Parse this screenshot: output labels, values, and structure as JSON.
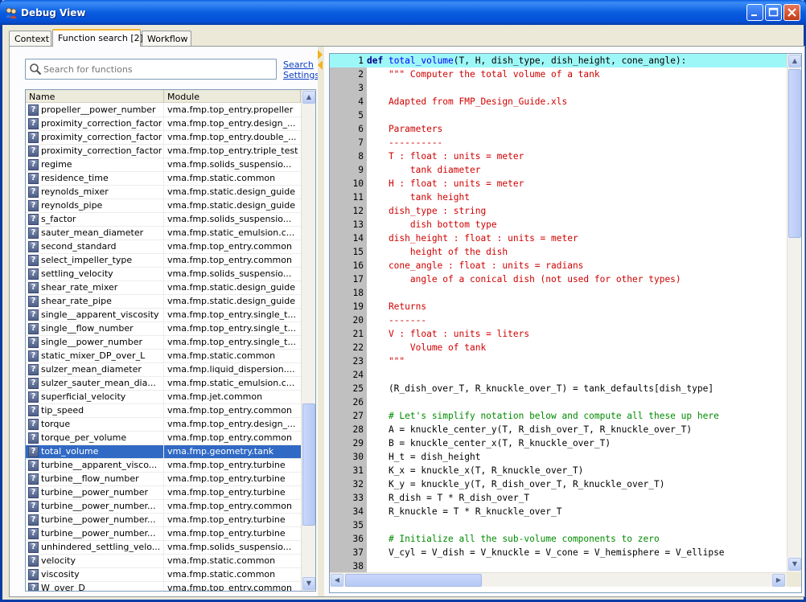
{
  "window": {
    "title": "Debug View"
  },
  "tabs": [
    {
      "label": "Context",
      "active": false
    },
    {
      "label": "Function search [2]",
      "active": true
    },
    {
      "label": "Workflow",
      "active": false
    }
  ],
  "search": {
    "placeholder": "Search for functions",
    "value": "",
    "settings_link": "Search Settings"
  },
  "list": {
    "columns": [
      "Name",
      "Module"
    ],
    "rows": [
      {
        "name": "propeller__power_number",
        "module": "vma.fmp.top_entry.propeller"
      },
      {
        "name": "proximity_correction_factor",
        "module": "vma.fmp.top_entry.design_..."
      },
      {
        "name": "proximity_correction_factor",
        "module": "vma.fmp.top_entry.double_..."
      },
      {
        "name": "proximity_correction_factor",
        "module": "vma.fmp.top_entry.triple_test"
      },
      {
        "name": "regime",
        "module": "vma.fmp.solids_suspensio..."
      },
      {
        "name": "residence_time",
        "module": "vma.fmp.static.common"
      },
      {
        "name": "reynolds_mixer",
        "module": "vma.fmp.static.design_guide"
      },
      {
        "name": "reynolds_pipe",
        "module": "vma.fmp.static.design_guide"
      },
      {
        "name": "s_factor",
        "module": "vma.fmp.solids_suspensio..."
      },
      {
        "name": "sauter_mean_diameter",
        "module": "vma.fmp.static_emulsion.c..."
      },
      {
        "name": "second_standard",
        "module": "vma.fmp.top_entry.common"
      },
      {
        "name": "select_impeller_type",
        "module": "vma.fmp.top_entry.common"
      },
      {
        "name": "settling_velocity",
        "module": "vma.fmp.solids_suspensio..."
      },
      {
        "name": "shear_rate_mixer",
        "module": "vma.fmp.static.design_guide"
      },
      {
        "name": "shear_rate_pipe",
        "module": "vma.fmp.static.design_guide"
      },
      {
        "name": "single__apparent_viscosity",
        "module": "vma.fmp.top_entry.single_t..."
      },
      {
        "name": "single__flow_number",
        "module": "vma.fmp.top_entry.single_t..."
      },
      {
        "name": "single__power_number",
        "module": "vma.fmp.top_entry.single_t..."
      },
      {
        "name": "static_mixer_DP_over_L",
        "module": "vma.fmp.static.common"
      },
      {
        "name": "sulzer_mean_diameter",
        "module": "vma.fmp.liquid_dispersion...."
      },
      {
        "name": "sulzer_sauter_mean_dia...",
        "module": "vma.fmp.static_emulsion.c..."
      },
      {
        "name": "superficial_velocity",
        "module": "vma.fmp.jet.common"
      },
      {
        "name": "tip_speed",
        "module": "vma.fmp.top_entry.common"
      },
      {
        "name": "torque",
        "module": "vma.fmp.top_entry.design_..."
      },
      {
        "name": "torque_per_volume",
        "module": "vma.fmp.top_entry.common"
      },
      {
        "name": "total_volume",
        "module": "vma.fmp.geometry.tank",
        "selected": true
      },
      {
        "name": "turbine__apparent_visco...",
        "module": "vma.fmp.top_entry.turbine"
      },
      {
        "name": "turbine__flow_number",
        "module": "vma.fmp.top_entry.turbine"
      },
      {
        "name": "turbine__power_number",
        "module": "vma.fmp.top_entry.turbine"
      },
      {
        "name": "turbine__power_number...",
        "module": "vma.fmp.top_entry.common"
      },
      {
        "name": "turbine__power_number...",
        "module": "vma.fmp.top_entry.turbine"
      },
      {
        "name": "turbine__power_number...",
        "module": "vma.fmp.top_entry.turbine"
      },
      {
        "name": "unhindered_settling_velo...",
        "module": "vma.fmp.solids_suspensio..."
      },
      {
        "name": "velocity",
        "module": "vma.fmp.static.common"
      },
      {
        "name": "viscosity",
        "module": "vma.fmp.static.common"
      },
      {
        "name": "W_over_D",
        "module": "vma.fmp.top_entry.common"
      }
    ]
  },
  "editor": {
    "current_line": 1,
    "lines": [
      [
        {
          "c": "kw",
          "t": "def "
        },
        {
          "c": "fn",
          "t": "total_volume"
        },
        {
          "c": "",
          "t": "(T, H, dish_type, dish_height, cone_angle):"
        }
      ],
      [
        {
          "c": "st",
          "t": "    \"\"\" Computer the total volume of a tank"
        }
      ],
      [],
      [
        {
          "c": "st",
          "t": "    Adapted from FMP_Design_Guide.xls"
        }
      ],
      [],
      [
        {
          "c": "st",
          "t": "    Parameters"
        }
      ],
      [
        {
          "c": "st",
          "t": "    ----------"
        }
      ],
      [
        {
          "c": "st",
          "t": "    T : float : units = meter"
        }
      ],
      [
        {
          "c": "st",
          "t": "        tank diameter"
        }
      ],
      [
        {
          "c": "st",
          "t": "    H : float : units = meter"
        }
      ],
      [
        {
          "c": "st",
          "t": "        tank height"
        }
      ],
      [
        {
          "c": "st",
          "t": "    dish_type : string"
        }
      ],
      [
        {
          "c": "st",
          "t": "        dish bottom type"
        }
      ],
      [
        {
          "c": "st",
          "t": "    dish_height : float : units = meter"
        }
      ],
      [
        {
          "c": "st",
          "t": "        height of the dish"
        }
      ],
      [
        {
          "c": "st",
          "t": "    cone_angle : float : units = radians"
        }
      ],
      [
        {
          "c": "st",
          "t": "        angle of a conical dish (not used for other types)"
        }
      ],
      [],
      [
        {
          "c": "st",
          "t": "    Returns"
        }
      ],
      [
        {
          "c": "st",
          "t": "    -------"
        }
      ],
      [
        {
          "c": "st",
          "t": "    V : float : units = liters"
        }
      ],
      [
        {
          "c": "st",
          "t": "        Volume of tank"
        }
      ],
      [
        {
          "c": "st",
          "t": "    \"\"\""
        }
      ],
      [],
      [
        {
          "c": "",
          "t": "    (R_dish_over_T, R_knuckle_over_T) = tank_defaults[dish_type]"
        }
      ],
      [],
      [
        {
          "c": "cm",
          "t": "    # Let's simplify notation below and compute all these up here"
        }
      ],
      [
        {
          "c": "",
          "t": "    A = knuckle_center_y(T, R_dish_over_T, R_knuckle_over_T)"
        }
      ],
      [
        {
          "c": "",
          "t": "    B = knuckle_center_x(T, R_knuckle_over_T)"
        }
      ],
      [
        {
          "c": "",
          "t": "    H_t = dish_height"
        }
      ],
      [
        {
          "c": "",
          "t": "    K_x = knuckle_x(T, R_knuckle_over_T)"
        }
      ],
      [
        {
          "c": "",
          "t": "    K_y = knuckle_y(T, R_dish_over_T, R_knuckle_over_T)"
        }
      ],
      [
        {
          "c": "",
          "t": "    R_dish = T * R_dish_over_T"
        }
      ],
      [
        {
          "c": "",
          "t": "    R_knuckle = T * R_knuckle_over_T"
        }
      ],
      [],
      [
        {
          "c": "cm",
          "t": "    # Initialize all the sub-volume components to zero"
        }
      ],
      [
        {
          "c": "",
          "t": "    V_cyl = V_dish = V_knuckle = V_cone = V_hemisphere = V_ellipse"
        }
      ],
      []
    ]
  }
}
